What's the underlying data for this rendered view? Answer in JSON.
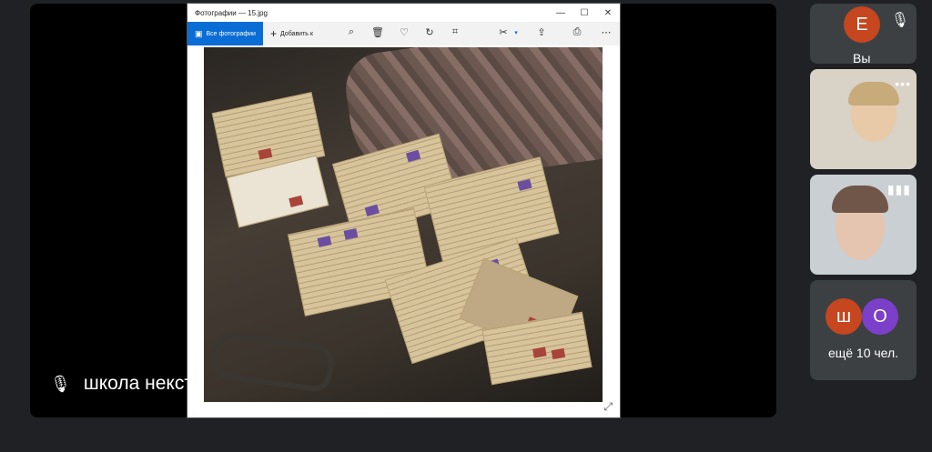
{
  "window": {
    "title": "Фотографии — 15.jpg",
    "controls": {
      "minimize": "—",
      "maximize": "☐",
      "close": "✕"
    }
  },
  "toolbar": {
    "all_photos_label": "Все фотографии",
    "add_to_label": "Добавить к"
  },
  "presenter": {
    "name": "школа некст"
  },
  "participants": {
    "you": {
      "initial": "E",
      "label": "Вы",
      "color": "#c5461f"
    },
    "more": {
      "avatars": [
        {
          "initial": "ш",
          "color": "#c5461f"
        },
        {
          "initial": "О",
          "color": "#7b3fc9"
        }
      ],
      "label": "ещё 10 чел."
    }
  }
}
